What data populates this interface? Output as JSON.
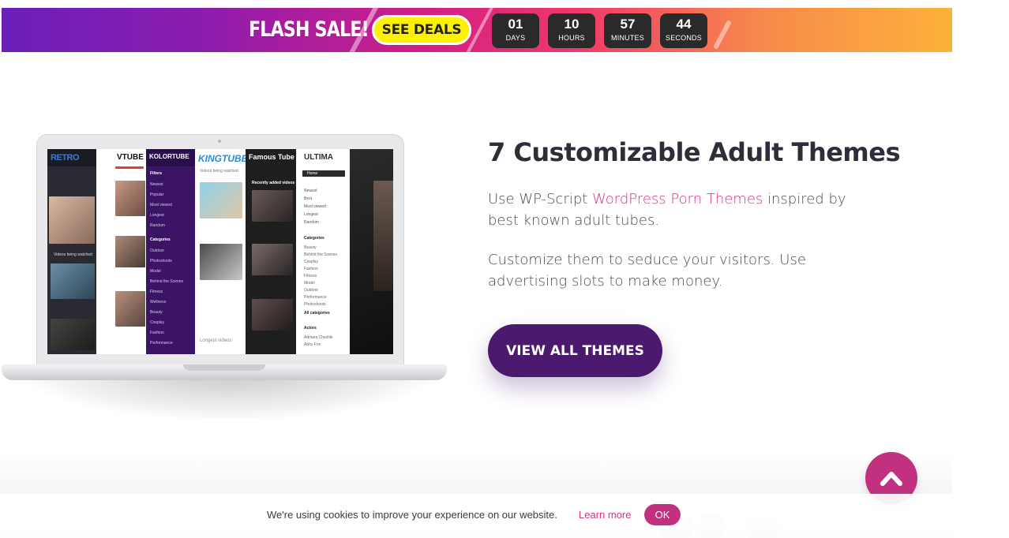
{
  "banner": {
    "title": "FLASH SALE!",
    "cta": "SEE DEALS",
    "countdown": [
      {
        "value": "01",
        "unit": "DAYS"
      },
      {
        "value": "10",
        "unit": "HOURS"
      },
      {
        "value": "57",
        "unit": "MINUTES"
      },
      {
        "value": "44",
        "unit": "SECONDS"
      }
    ]
  },
  "mockup": {
    "themes": [
      "RETRO",
      "VTUBE",
      "KOLORTUBE",
      "KINGTUBE",
      "Famous Tube",
      "ULTIMA"
    ],
    "kolortube_filters_label": "Filters",
    "kolortube_filters": [
      "Newest",
      "Popular",
      "Most viewed",
      "Longest",
      "Random"
    ],
    "kolortube_categories_label": "Categories",
    "kolortube_categories": [
      "Outdoor",
      "Photoshoots",
      "Model",
      "Behind the Scenes",
      "Fitness",
      "Wellness",
      "Beauty",
      "Cosplay",
      "Fashion",
      "Performance"
    ],
    "king_section": "Videos being watched",
    "king_longest": "Longest videos",
    "famous_section": "Recently added videos",
    "ultima_home": "Home",
    "ultima_filters": [
      "Newest",
      "Best",
      "Most viewed",
      "Longest",
      "Random"
    ],
    "ultima_categories_label": "Categories",
    "ultima_categories": [
      "Beauty",
      "Behind the Scenes",
      "Cosplay",
      "Fashion",
      "Fitness",
      "Model",
      "Outdoor",
      "Performance",
      "Photoshoots",
      "All categories"
    ],
    "ultima_actors_label": "Actors",
    "ultima_actors": [
      "Adriana Chechik",
      "Abby Fox"
    ],
    "retro_section": "Videos being watched"
  },
  "content": {
    "title": "7 Customizable Adult Themes",
    "para1_before": "Use WP-Script ",
    "para1_link": "WordPress Porn Themes",
    "para1_after": " inspired by best known adult tubes.",
    "para2": "Customize them to seduce your visitors. Use advertising slots to make money.",
    "button": "VIEW ALL THEMES"
  },
  "cookie": {
    "text": "We're using cookies to improve your experience on our website.",
    "link": "Learn more",
    "ok": "OK"
  },
  "colors": {
    "accent": "#c1317f",
    "button": "#4b1a6e",
    "link": "#d63384"
  },
  "icons": {
    "scroll_top": "chevron-up-icon"
  }
}
